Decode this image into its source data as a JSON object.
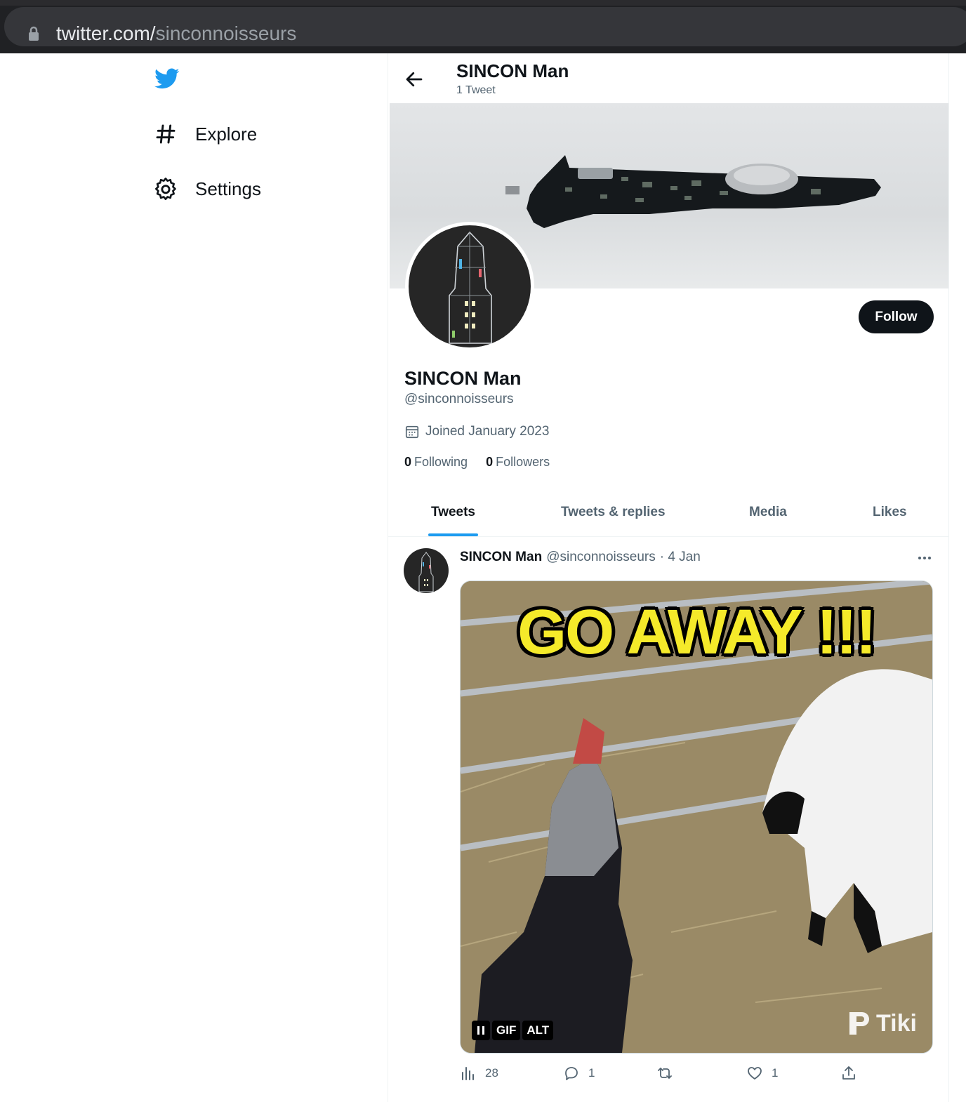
{
  "browser": {
    "url_host": "twitter.com/",
    "url_path": "sinconnoisseurs"
  },
  "sidebar": {
    "items": [
      {
        "label": "Explore",
        "icon": "hashtag-icon"
      },
      {
        "label": "Settings",
        "icon": "gear-icon"
      }
    ]
  },
  "header": {
    "name": "SINCON Man",
    "tweet_count": "1 Tweet"
  },
  "profile": {
    "name": "SINCON Man",
    "handle": "@sinconnoisseurs",
    "joined": "Joined January 2023",
    "following_count": "0",
    "following_label": "Following",
    "followers_count": "0",
    "followers_label": "Followers",
    "follow_label": "Follow"
  },
  "tabs": [
    {
      "label": "Tweets",
      "active": true
    },
    {
      "label": "Tweets & replies",
      "active": false
    },
    {
      "label": "Media",
      "active": false
    },
    {
      "label": "Likes",
      "active": false
    }
  ],
  "tweet": {
    "name": "SINCON Man",
    "handle": "@sinconnoisseurs",
    "date": "· 4 Jan",
    "media": {
      "caption": "GO AWAY !!!",
      "gif_label": "GIF",
      "alt_label": "ALT",
      "watermark": "Tiki"
    },
    "views": "28",
    "replies": "1",
    "retweets": "",
    "likes": "1"
  },
  "colors": {
    "accent": "#1d9bf0",
    "text": "#0f1419",
    "muted": "#536471"
  }
}
